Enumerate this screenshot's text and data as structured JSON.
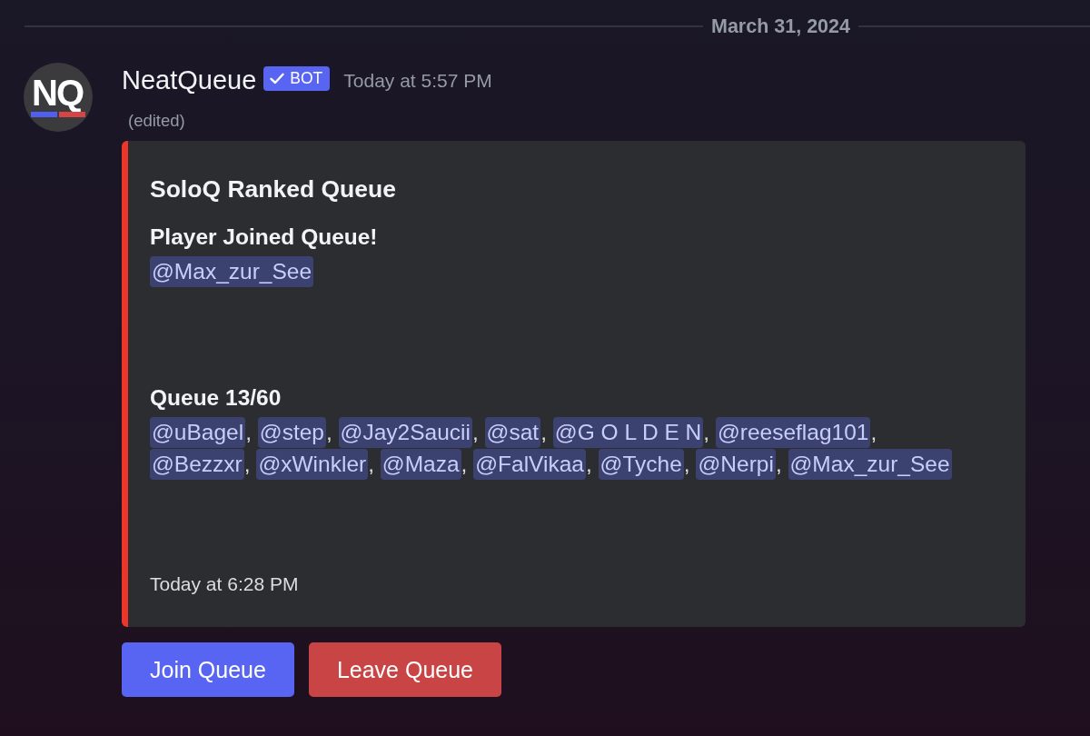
{
  "date_divider": {
    "label": "March 31, 2024"
  },
  "message": {
    "avatar": {
      "initials": "NQ"
    },
    "author": "NeatQueue",
    "badge": {
      "label": "BOT",
      "verified": true
    },
    "timestamp": "Today at 5:57 PM",
    "edited_note": "(edited)"
  },
  "embed": {
    "title": "SoloQ Ranked Queue",
    "separator": ", ",
    "fields": [
      {
        "name": "Player Joined Queue!",
        "mentions": [
          "@Max_zur_See"
        ]
      },
      {
        "name": "Queue 13/60",
        "mentions": [
          "@uBagel",
          "@step",
          "@Jay2Saucii",
          "@sat",
          "@G O L D E N",
          "@reeseflag101",
          "@Bezzxr",
          "@xWinkler",
          "@Maza",
          "@FalVikaa",
          "@Tyche",
          "@Nerpi",
          "@Max_zur_See"
        ]
      }
    ],
    "footer": "Today at 6:28 PM"
  },
  "buttons": [
    {
      "label": "Join Queue",
      "kind": "primary"
    },
    {
      "label": "Leave Queue",
      "kind": "danger"
    }
  ]
}
